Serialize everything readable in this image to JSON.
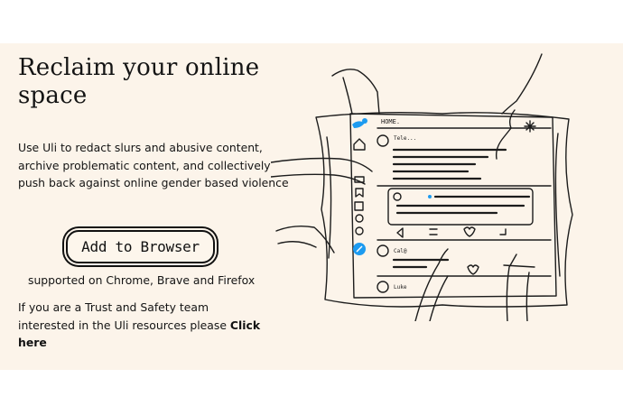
{
  "hero": {
    "title": "Reclaim your online space",
    "description": "Use Uli to redact slurs and abusive content, archive problematic content, and collectively push back against online gender based violence",
    "cta_label": "Add to Browser",
    "supported": "supported on Chrome, Brave and Firefox",
    "team_text": "If you are a Trust and Safety team interested in the Uli resources please ",
    "team_link": "Click here"
  },
  "illustration": {
    "header_label": "HOME.",
    "post1_handle": "Tele...",
    "post3_handle": "Cal@",
    "post4_handle": "Luke"
  },
  "colors": {
    "band_background": "#fcf4ea",
    "text": "#141414",
    "twitter_blue": "#1d9bf0"
  }
}
